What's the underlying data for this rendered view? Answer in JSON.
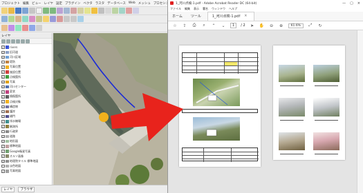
{
  "qgis": {
    "menu": [
      "プロジェクト",
      "編集",
      "ビュー",
      "レイヤ",
      "設定",
      "プラグイン",
      "ベクタ",
      "ラスタ",
      "データベース",
      "Web",
      "メッシュ",
      "プロセシング",
      "ヘルプ"
    ],
    "layers_panel": {
      "title": "レイヤ",
      "items": [
        {
          "label": "rivers",
          "checked": true,
          "color": "#3a56d6"
        },
        {
          "label": "旧河道",
          "checked": true,
          "color": "#8ba0c8"
        },
        {
          "label": "河川区域",
          "checked": true,
          "color": "#6fa0d8"
        },
        {
          "label": "堤防",
          "checked": false,
          "color": "#c08040"
        },
        {
          "label": "写真位置",
          "checked": true,
          "color": "#f2b11d"
        },
        {
          "label": "施設位置",
          "checked": true,
          "color": "#d04040"
        },
        {
          "label": "点検箇所",
          "checked": true,
          "color": "#40a040"
        },
        {
          "label": "写真",
          "checked": true,
          "color": "#e0a000"
        },
        {
          "label": "河川センター",
          "checked": true,
          "color": "#5070b0"
        },
        {
          "label": "変状",
          "checked": true,
          "color": "#c04080"
        },
        {
          "label": "損傷箇所",
          "checked": true,
          "color": "#606060"
        },
        {
          "label": "点検対象",
          "checked": true,
          "color": "#f2b11d"
        },
        {
          "label": "構造物",
          "checked": true,
          "color": "#7070a0"
        },
        {
          "label": "護岸",
          "checked": true,
          "color": "#a07050"
        },
        {
          "label": "樋門",
          "checked": true,
          "color": "#505090"
        },
        {
          "label": "排水機場",
          "checked": true,
          "color": "#409090"
        },
        {
          "label": "観測所",
          "checked": true,
          "color": "#908040"
        },
        {
          "label": "行政界",
          "checked": false,
          "color": "#888888"
        },
        {
          "label": "道路",
          "checked": true,
          "color": "#b0b0b0"
        },
        {
          "label": "地形図",
          "checked": true,
          "color": "#a0c0a0"
        },
        {
          "label": "標準地図",
          "checked": true,
          "color": "#c0a0a0"
        },
        {
          "label": "Google衛星写真",
          "checked": true,
          "color": "#70a070"
        },
        {
          "label": "オルソ画像",
          "checked": true,
          "color": "#8a8a6c"
        },
        {
          "label": "地理院タイル 標準地図",
          "checked": true,
          "color": "#909090"
        },
        {
          "label": "淡色地図",
          "checked": false,
          "color": "#b0b0b0"
        },
        {
          "label": "写真地図",
          "checked": true,
          "color": "#a0a0a0"
        }
      ]
    },
    "statusbar": [
      "レイヤ",
      "ブラウザ"
    ]
  },
  "acrobat": {
    "title": "1_河川点検-1.pdf - Adobe Acrobat Reader DC (64-bit)",
    "menu": [
      "ファイル",
      "編集",
      "表示",
      "署名",
      "ウィンドウ",
      "ヘルプ"
    ],
    "tabs": {
      "home": "ホーム",
      "tools": "ツール",
      "doc": "1_河川点検-1.pdf"
    },
    "page_current": "1",
    "page_total": "/ 2",
    "zoom": "61.6%",
    "close_glyph": "×",
    "min_glyph": "—",
    "max_glyph": "▢"
  },
  "colors": {
    "qgis_river_line": "#1b2bd6",
    "marker": "#f2b11d",
    "arrow": "#e8231c"
  }
}
